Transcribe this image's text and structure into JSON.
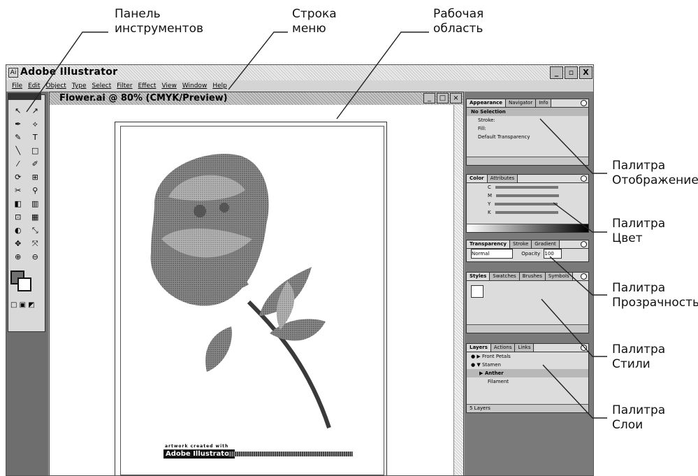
{
  "callouts": {
    "toolbox": "Панель\nинструментов",
    "menubar": "Строка\nменю",
    "workarea": "Рабочая\nобласть",
    "appearance": "Палитра\nОтображение",
    "color": "Палитра\nЦвет",
    "transparency": "Палитра\nПрозрачность",
    "styles": "Палитра\nСтили",
    "layers": "Палитра\nСлои"
  },
  "app": {
    "title": "Adobe Illustrator",
    "window_buttons": [
      "_",
      "▫",
      "X"
    ]
  },
  "menu": [
    "File",
    "Edit",
    "Object",
    "Type",
    "Select",
    "Filter",
    "Effect",
    "View",
    "Window",
    "Help"
  ],
  "document": {
    "title": "Flower.ai @ 80% (CMYK/Preview)",
    "badge_caption": "artwork created with",
    "badge_text": "Adobe Illustrator"
  },
  "toolbox": {
    "tools": [
      "↖",
      "↗",
      "✒",
      "⟡",
      "✎",
      "T",
      "╲",
      "□",
      "⁄",
      "✐",
      "⟳",
      "⊞",
      "✂",
      "⚲",
      "◧",
      "▥",
      "⊡",
      "▦",
      "◐",
      "⤡",
      "✥",
      "⤧",
      "⊕",
      "⊖"
    ],
    "modes": "□ ▣ ◩"
  },
  "palettes": {
    "appearance": {
      "tabs": [
        "Appearance",
        "Navigator",
        "Info"
      ],
      "rows": [
        "No Selection",
        "Stroke:",
        "Fill:",
        "Default Transparency"
      ]
    },
    "color": {
      "tabs": [
        "Color",
        "Attributes"
      ],
      "channels": [
        "C",
        "M",
        "Y",
        "K"
      ]
    },
    "transparency": {
      "tabs": [
        "Transparency",
        "Stroke",
        "Gradient"
      ],
      "mode": "Normal",
      "opacity_label": "Opacity",
      "opacity_value": "100"
    },
    "styles": {
      "tabs": [
        "Styles",
        "Swatches",
        "Brushes",
        "Symbols"
      ]
    },
    "layers": {
      "tabs": [
        "Layers",
        "Actions",
        "Links"
      ],
      "rows": [
        "Front Petals",
        "Stamen",
        "Anther",
        "Filament"
      ],
      "footer": "5 Layers"
    }
  }
}
